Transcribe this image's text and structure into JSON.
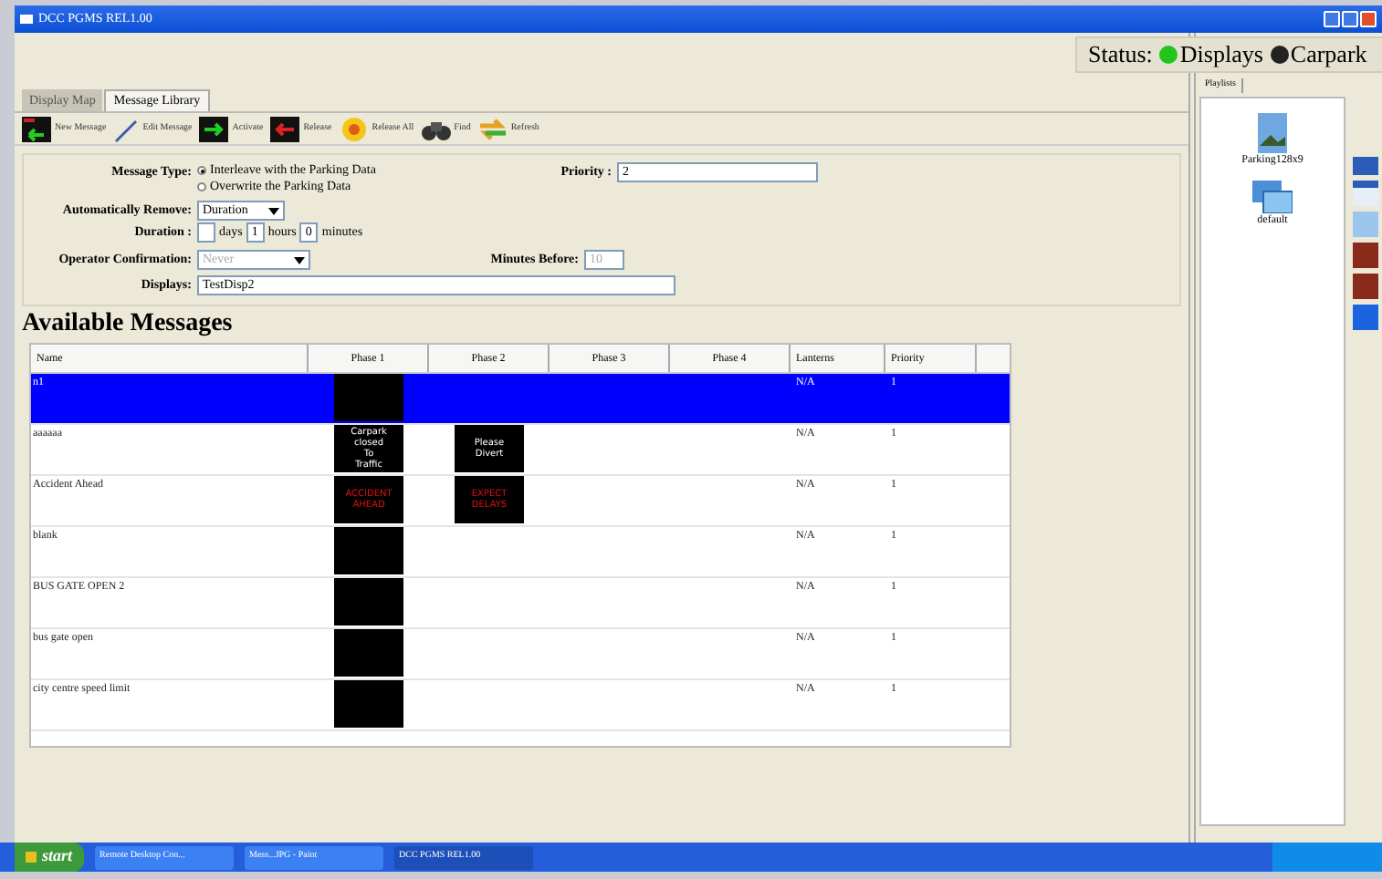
{
  "window": {
    "title": "DCC PGMS REL1.00"
  },
  "status": {
    "label": "Status:",
    "indicators": [
      {
        "label": "Displays",
        "color": "#22c51e"
      },
      {
        "label": "Carpark",
        "color": "#222222"
      }
    ]
  },
  "tabs": [
    {
      "label": "Display Map",
      "selected": false
    },
    {
      "label": "Message Library",
      "selected": true
    }
  ],
  "toolbar": [
    {
      "label": "New Message",
      "kind": "newmsg"
    },
    {
      "label": "Edit Message",
      "kind": "pen"
    },
    {
      "label": "Activate",
      "kind": "activate"
    },
    {
      "label": "Release",
      "kind": "release"
    },
    {
      "label": "Release All",
      "kind": "releaseall"
    },
    {
      "label": "Find",
      "kind": "find"
    },
    {
      "label": "Refresh",
      "kind": "refresh"
    }
  ],
  "form": {
    "message_type": {
      "label": "Message Type:",
      "options": [
        {
          "label": "Interleave with the Parking Data",
          "selected": true
        },
        {
          "label": "Overwrite the Parking Data",
          "selected": false
        }
      ]
    },
    "priority": {
      "label": "Priority :",
      "value": "2"
    },
    "auto_remove": {
      "label": "Automatically Remove:",
      "value": "Duration"
    },
    "duration": {
      "label": "Duration :",
      "days_label": "days",
      "hours": "1",
      "hours_label": "hours",
      "minutes": "0",
      "minutes_label": "minutes"
    },
    "operator_confirmation": {
      "label": "Operator Confirmation:",
      "value": "Never",
      "disabled": true
    },
    "minutes_before": {
      "label": "Minutes Before:",
      "value": "10",
      "disabled": true
    },
    "displays": {
      "label": "Displays:",
      "value": "TestDisp2"
    }
  },
  "messages": {
    "title": "Available Messages",
    "columns": [
      "Name",
      "Phase 1",
      "Phase 2",
      "Phase 3",
      "Phase 4",
      "Lanterns",
      "Priority"
    ],
    "rows": [
      {
        "name": "n1",
        "selected": true,
        "phases": [
          {
            "kind": "blank"
          }
        ],
        "lanterns": "N/A",
        "priority": "1"
      },
      {
        "name": "aaaaaa",
        "selected": false,
        "phases": [
          {
            "kind": "text",
            "lines": [
              "Carpark",
              "closed",
              "To",
              "Traffic"
            ],
            "color": "#ffffff"
          },
          {
            "kind": "text",
            "lines": [
              "Please",
              "Divert"
            ],
            "color": "#ffffff"
          }
        ],
        "lanterns": "N/A",
        "priority": "1"
      },
      {
        "name": "Accident Ahead",
        "selected": false,
        "phases": [
          {
            "kind": "text",
            "lines": [
              "ACCIDENT",
              "AHEAD"
            ],
            "color": "#e01010"
          },
          {
            "kind": "text",
            "lines": [
              "EXPECT",
              "DELAYS"
            ],
            "color": "#e01010"
          }
        ],
        "lanterns": "N/A",
        "priority": "1"
      },
      {
        "name": "blank",
        "selected": false,
        "phases": [
          {
            "kind": "blank"
          }
        ],
        "lanterns": "N/A",
        "priority": "1"
      },
      {
        "name": "BUS GATE OPEN 2",
        "selected": false,
        "phases": [
          {
            "kind": "blank"
          }
        ],
        "lanterns": "N/A",
        "priority": "1"
      },
      {
        "name": "bus gate open",
        "selected": false,
        "phases": [
          {
            "kind": "blank"
          }
        ],
        "lanterns": "N/A",
        "priority": "1"
      },
      {
        "name": "city centre speed limit",
        "selected": false,
        "phases": [
          {
            "kind": "blank"
          }
        ],
        "lanterns": "N/A",
        "priority": "1"
      }
    ]
  },
  "playlists": {
    "tab": "Playlists",
    "items": [
      {
        "label": "Parking128x9",
        "kind": "single"
      },
      {
        "label": "default",
        "kind": "multi"
      }
    ]
  },
  "taskbar": {
    "start": "start",
    "tasks": [
      {
        "label": "Remote Desktop Con...",
        "selected": false
      },
      {
        "label": "Mess...JPG - Paint",
        "selected": false
      },
      {
        "label": "DCC PGMS REL1.00",
        "selected": true
      }
    ]
  }
}
